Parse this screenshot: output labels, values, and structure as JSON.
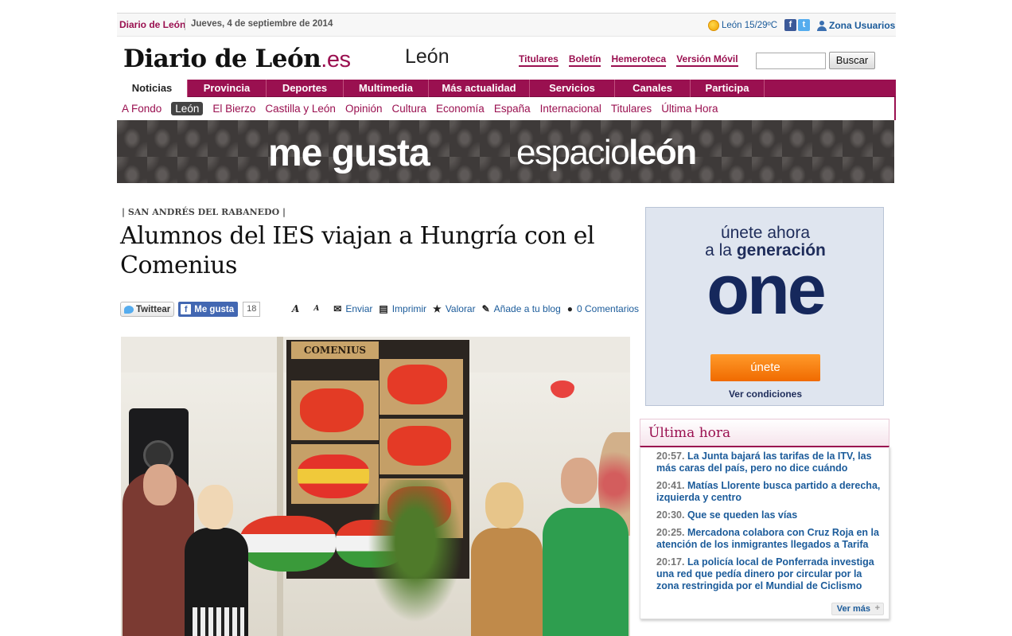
{
  "topbar": {
    "site": "Diario de León",
    "date": "Jueves, 4 de septiembre de 2014",
    "weather": "León 15/29ºC",
    "users": "Zona Usuarios"
  },
  "header": {
    "logo_main": "Diario de León",
    "logo_suffix": ".es",
    "city": "León",
    "links": [
      "Titulares",
      "Boletín",
      "Hemeroteca",
      "Versión Móvil"
    ],
    "search_value": "",
    "search_button": "Buscar"
  },
  "mainnav": [
    "Noticias",
    "Provincia",
    "Deportes",
    "Multimedia",
    "Más actualidad",
    "Servicios",
    "Canales",
    "Participa"
  ],
  "subnav": [
    "A Fondo",
    "León",
    "El Bierzo",
    "Castilla y León",
    "Opinión",
    "Cultura",
    "Economía",
    "España",
    "Internacional",
    "Titulares",
    "Última Hora"
  ],
  "banner": {
    "left": "me gusta",
    "right_light": "espacio",
    "right_bold": "león"
  },
  "article": {
    "kicker": "| SAN ANDRÉS DEL RABANEDO |",
    "headline": "Alumnos del IES viajan a Hungría con el Comenius",
    "twitter": "Twittear",
    "facebook": "Me gusta",
    "likes": "18",
    "tools": {
      "font_big": "A",
      "font_small": "A",
      "send": "Enviar",
      "print": "Imprimir",
      "rate": "Valorar",
      "blog": "Añade a tu blog",
      "comments": "0 Comentarios"
    },
    "photo_sign": "COMENIUS"
  },
  "ad": {
    "line1": "únete ahora",
    "line2_light": "a la ",
    "line2_bold": "generación",
    "brand": "one",
    "button": "únete",
    "conditions": "Ver condiciones"
  },
  "ultima": {
    "title": "Última hora",
    "news": [
      {
        "time": "20:57.",
        "text": "La Junta bajará las tarifas de la ITV, las más caras del país, pero no dice cuándo"
      },
      {
        "time": "20:41.",
        "text": "Matías Llorente busca partido a derecha, izquierda y centro"
      },
      {
        "time": "20:30.",
        "text": "Que se queden las vías"
      },
      {
        "time": "20:25.",
        "text": "Mercadona colabora con Cruz Roja en la atención de los inmigrantes llegados a Tarifa"
      },
      {
        "time": "20:17.",
        "text": "La policía local de Ponferrada investiga una red que pedía dinero por circular por la zona restringida por el Mundial de Ciclismo"
      }
    ],
    "more": "Ver más"
  },
  "colors": {
    "brand": "#9a1050",
    "link": "#1b5b9a",
    "ad_button": "#f07800"
  }
}
